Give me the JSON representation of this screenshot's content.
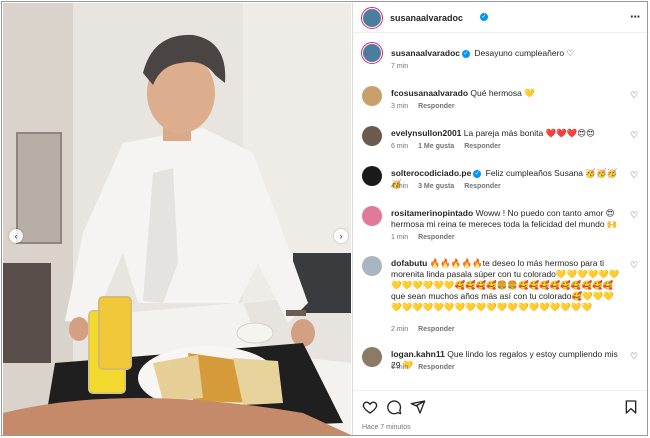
{
  "post": {
    "username": "susanaalvaradoc",
    "caption": "Desayuno cumpleañero",
    "caption_emoji": "♡",
    "caption_time": "7 min",
    "posted_ago": "Hace 7 minutos"
  },
  "labels": {
    "reply": "Responder"
  },
  "comments": [
    {
      "user": "fcosusanaalvarado",
      "text": "Qué hermosa 💛",
      "time": "3 min",
      "likes": "",
      "avatar_color": "#c9a06c"
    },
    {
      "user": "evelynsullon2001",
      "text": "La pareja más bonita ❤️❤️❤️😍😍",
      "time": "6 min",
      "likes": "1 Me gusta",
      "avatar_color": "#6b5b4e"
    },
    {
      "user": "solterocodiciado.pe",
      "verified": true,
      "text": "Feliz cumpleaños Susana 🥳🥳🥳🥳",
      "time": "4 min",
      "likes": "3 Me gusta",
      "avatar_color": "#1a1a1a"
    },
    {
      "user": "rositamerinopintado",
      "text": "Woww ! No puedo con tanto amor 😍 hermosa mi reina te mereces toda la felicidad del mundo 🙌",
      "time": "1 min",
      "likes": "",
      "avatar_color": "#e07a9a"
    },
    {
      "user": "dofabutu",
      "text": "🔥🔥🔥🔥🔥te deseo lo más hermoso para ti morenita linda pasala súper con tu colorado💛💛💛💛💛💛💛💛💛💛💛💛🥰🥰🥰🥰🍔🍔🥰🥰🥰🥰🥰🥰🥰🥰🥰que sean muchos años más así con tu colorado🥰💛💛💛💛💛💛💛💛💛💛💛💛💛💛💛💛💛💛💛💛💛💛",
      "time": "2 min",
      "likes": "",
      "avatar_color": "#a9b6c2"
    },
    {
      "user": "logan.kahn11",
      "text": "Que lindo los regalos y estoy cumpliendo mis 29 💛",
      "time": "6 min",
      "likes": "",
      "avatar_color": "#8a7a66"
    }
  ],
  "icons": {
    "more": "more-icon",
    "heart": "heart-icon",
    "comment": "comment-icon",
    "share": "share-icon",
    "save": "save-icon",
    "carousel_left": "chevron-left-icon",
    "carousel_right": "chevron-right-icon"
  },
  "colors": {
    "link_blue": "#0095f6",
    "meta_gray": "#737373",
    "ring": "#d62976"
  }
}
